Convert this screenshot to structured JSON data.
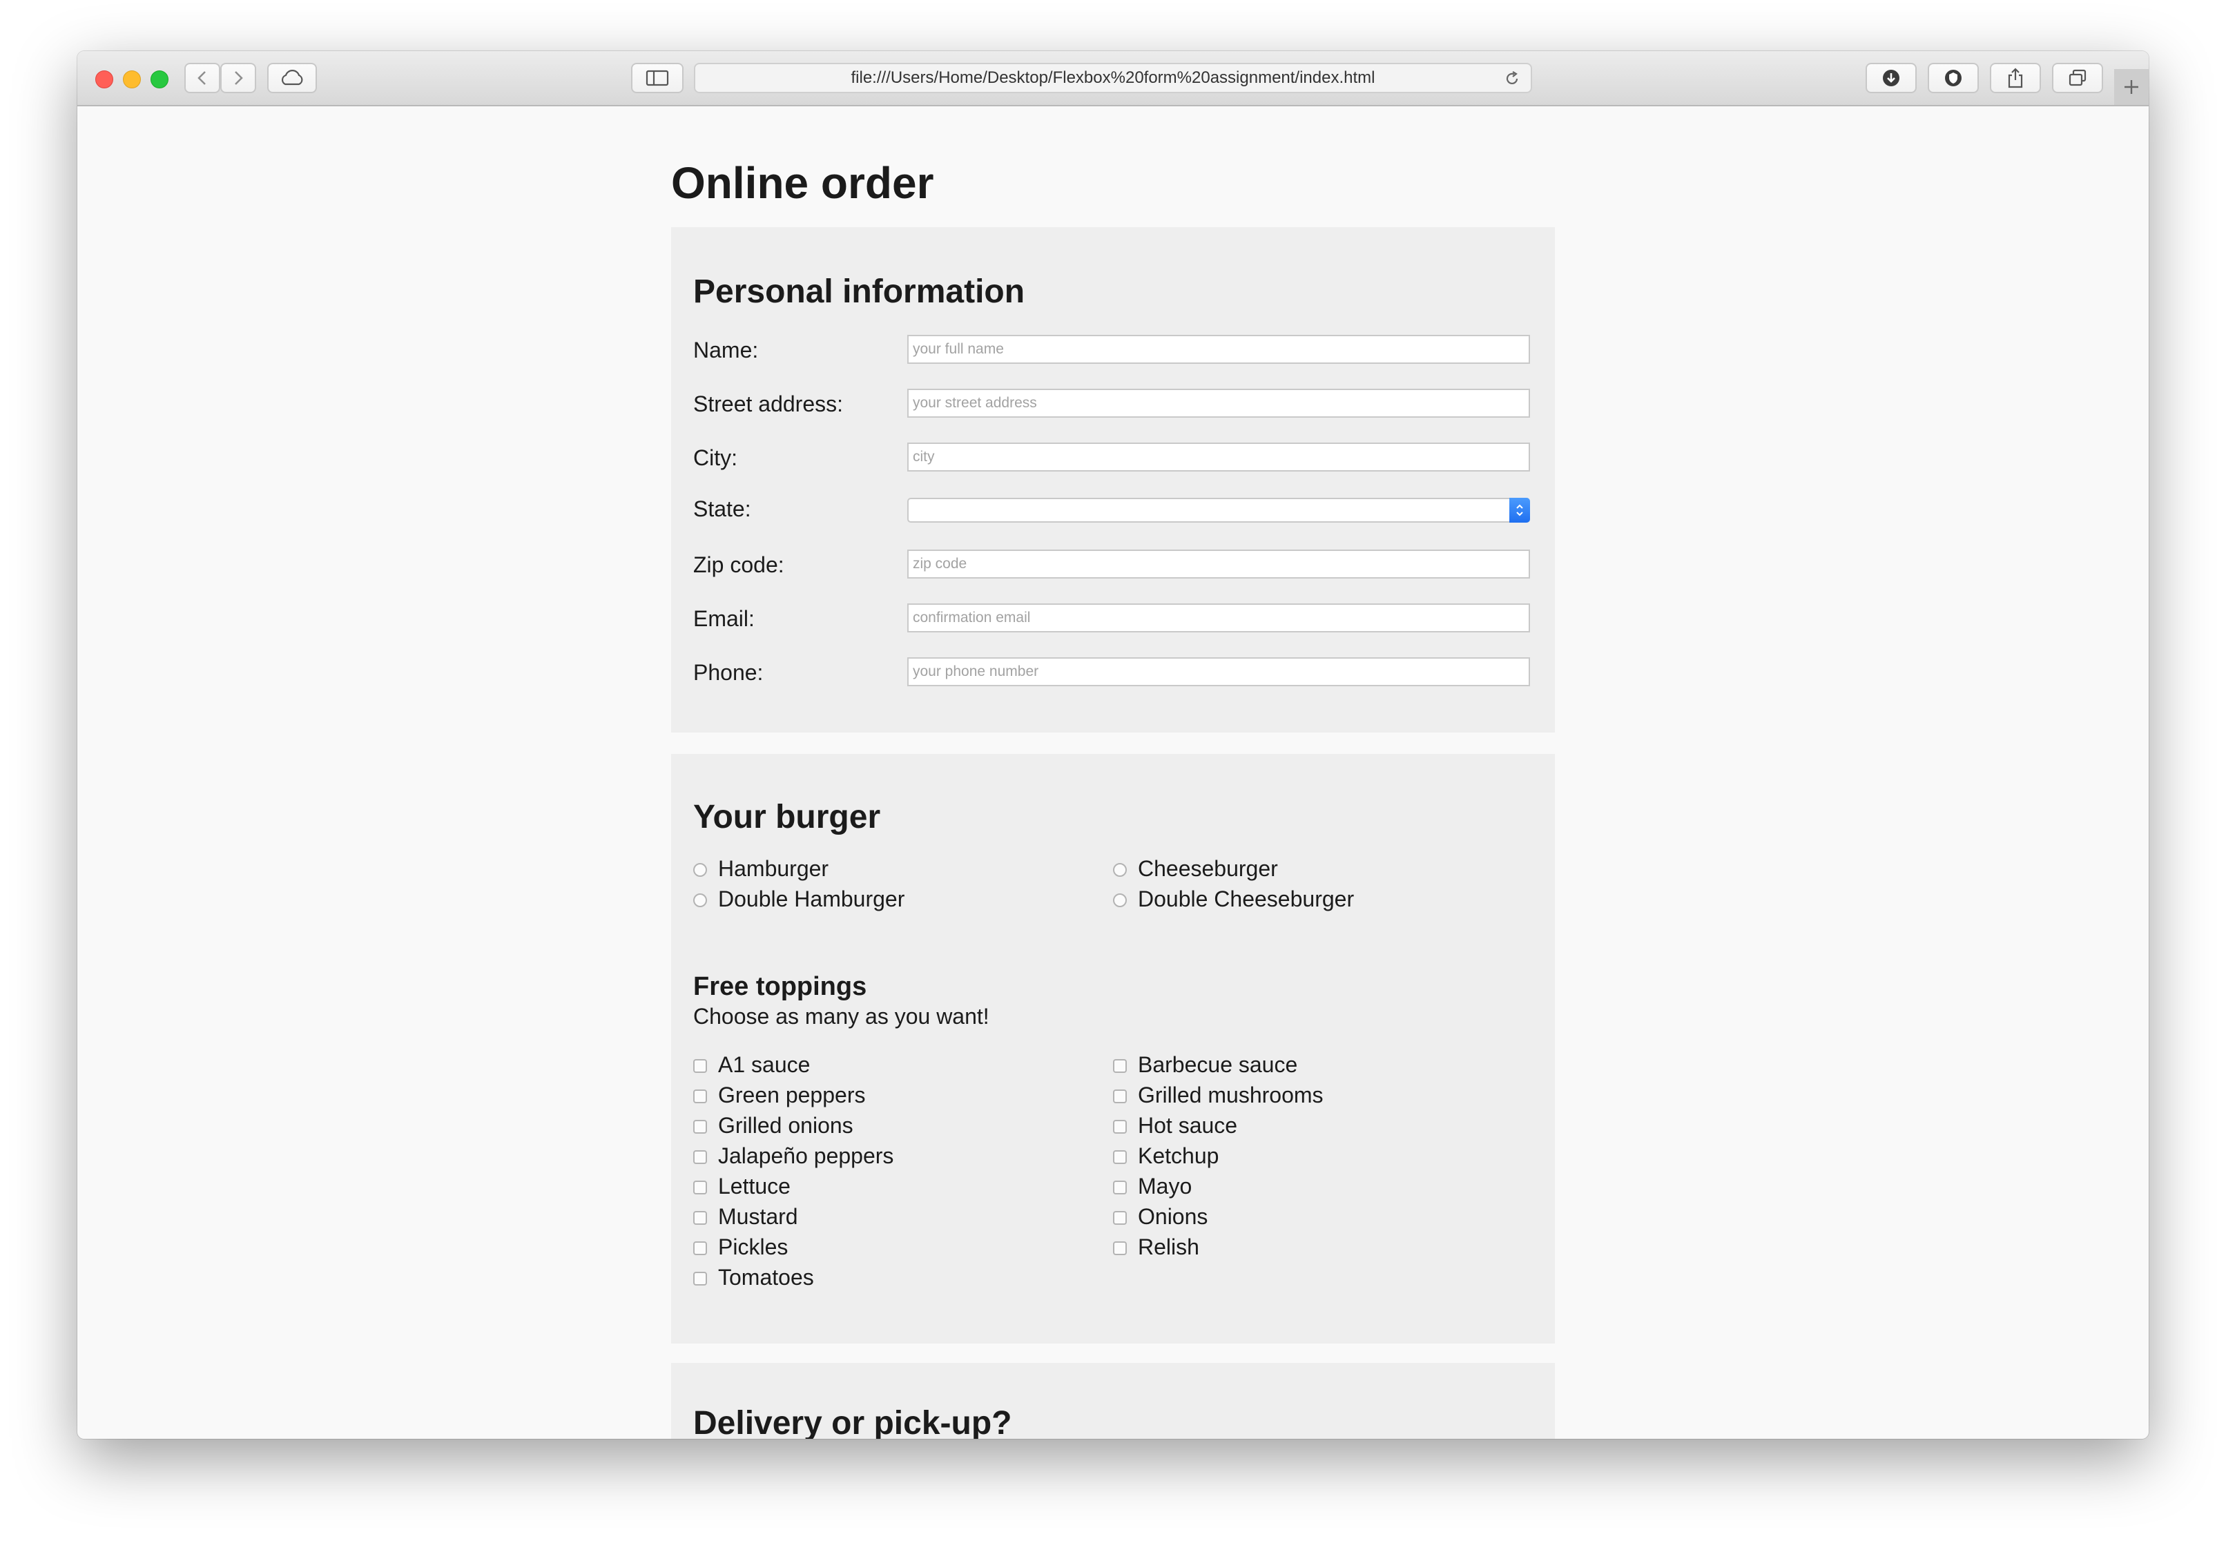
{
  "browser": {
    "url": "file:///Users/Home/Desktop/Flexbox%20form%20assignment/index.html",
    "icons": {
      "back": "chevron-left-icon",
      "forward": "chevron-right-icon",
      "icloud": "cloud-icon",
      "sidebar": "sidebar-icon",
      "reload": "reload-icon",
      "downloads": "download-icon",
      "extension": "shield-icon",
      "share": "share-icon",
      "tabs": "tabs-overview-icon",
      "new_tab": "plus-icon"
    },
    "colors": {
      "close": "#ff5f57",
      "minimize": "#febc2e",
      "zoom": "#28c840"
    }
  },
  "page": {
    "title": "Online order",
    "personal": {
      "heading": "Personal information",
      "fields": [
        {
          "label": "Name:",
          "placeholder": "your full name",
          "value": ""
        },
        {
          "label": "Street address:",
          "placeholder": "your street address",
          "value": ""
        },
        {
          "label": "City:",
          "placeholder": "city",
          "value": ""
        },
        {
          "label": "State:",
          "type": "select",
          "value": ""
        },
        {
          "label": "Zip code:",
          "placeholder": "zip code",
          "value": ""
        },
        {
          "label": "Email:",
          "placeholder": "confirmation email",
          "value": ""
        },
        {
          "label": "Phone:",
          "placeholder": "your phone number",
          "value": ""
        }
      ]
    },
    "burger": {
      "heading": "Your burger",
      "options": [
        "Hamburger",
        "Cheeseburger",
        "Double Hamburger",
        "Double Cheeseburger"
      ]
    },
    "toppings": {
      "heading": "Free toppings",
      "subtitle": "Choose as many as you want!",
      "left": [
        "A1 sauce",
        "Green peppers",
        "Grilled onions",
        "Jalapeño peppers",
        "Lettuce",
        "Mustard",
        "Pickles",
        "Tomatoes"
      ],
      "right": [
        "Barbecue sauce",
        "Grilled mushrooms",
        "Hot sauce",
        "Ketchup",
        "Mayo",
        "Onions",
        "Relish"
      ]
    },
    "delivery": {
      "heading": "Delivery or pick-up?"
    }
  }
}
